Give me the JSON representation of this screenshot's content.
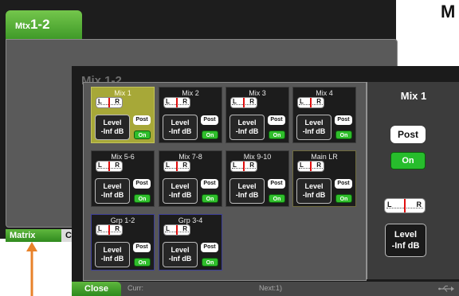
{
  "back_window": {
    "tab_prefix": "Mtx",
    "tab_title": "1-2",
    "bottom_tabs": [
      "Matrix View",
      "Cu"
    ],
    "corner_letter": "M"
  },
  "front_window": {
    "ghost_tab": "Mix 1-2",
    "cells": [
      {
        "name": "Mix 1",
        "level_label": "Level",
        "level_value": "-Inf dB",
        "post_label": "Post",
        "on_label": "On",
        "pan_left": "L",
        "pan_right": "R"
      },
      {
        "name": "Mix 2",
        "level_label": "Level",
        "level_value": "-Inf dB",
        "post_label": "Post",
        "on_label": "On",
        "pan_left": "L",
        "pan_right": "R"
      },
      {
        "name": "Mix 3",
        "level_label": "Level",
        "level_value": "-Inf dB",
        "post_label": "Post",
        "on_label": "On",
        "pan_left": "L",
        "pan_right": "R"
      },
      {
        "name": "Mix 4",
        "level_label": "Level",
        "level_value": "-Inf dB",
        "post_label": "Post",
        "on_label": "On",
        "pan_left": "L",
        "pan_right": "R"
      },
      {
        "name": "Mix 5-6",
        "level_label": "Level",
        "level_value": "-Inf dB",
        "post_label": "Post",
        "on_label": "On",
        "pan_left": "L",
        "pan_right": "R"
      },
      {
        "name": "Mix 7-8",
        "level_label": "Level",
        "level_value": "-Inf dB",
        "post_label": "Post",
        "on_label": "On",
        "pan_left": "L",
        "pan_right": "R"
      },
      {
        "name": "Mix 9-10",
        "level_label": "Level",
        "level_value": "-Inf dB",
        "post_label": "Post",
        "on_label": "On",
        "pan_left": "L",
        "pan_right": "R"
      },
      {
        "name": "Main LR",
        "level_label": "Level",
        "level_value": "-Inf dB",
        "post_label": "Post",
        "on_label": "On",
        "pan_left": "L",
        "pan_right": "R"
      },
      {
        "name": "Grp 1-2",
        "level_label": "Level",
        "level_value": "-Inf dB",
        "post_label": "Post",
        "on_label": "On",
        "pan_left": "L",
        "pan_right": "R"
      },
      {
        "name": "Grp 3-4",
        "level_label": "Level",
        "level_value": "-Inf dB",
        "post_label": "Post",
        "on_label": "On",
        "pan_left": "L",
        "pan_right": "R"
      }
    ],
    "panel": {
      "title": "Mix 1",
      "post_label": "Post",
      "on_label": "On",
      "pan_left": "L",
      "pan_right": "R",
      "level_label": "Level",
      "level_value": "-Inf dB"
    },
    "status": {
      "close_label": "Close",
      "curr_label": "Curr:",
      "next_label": "Next:1)"
    }
  },
  "colors": {
    "accent_green": "#3f9a28",
    "selected_cell": "#a7a838",
    "on_button": "#2fbe2b",
    "arrow": "#e8822a"
  },
  "icons": [
    "usb-icon",
    "arrow-up-icon"
  ]
}
